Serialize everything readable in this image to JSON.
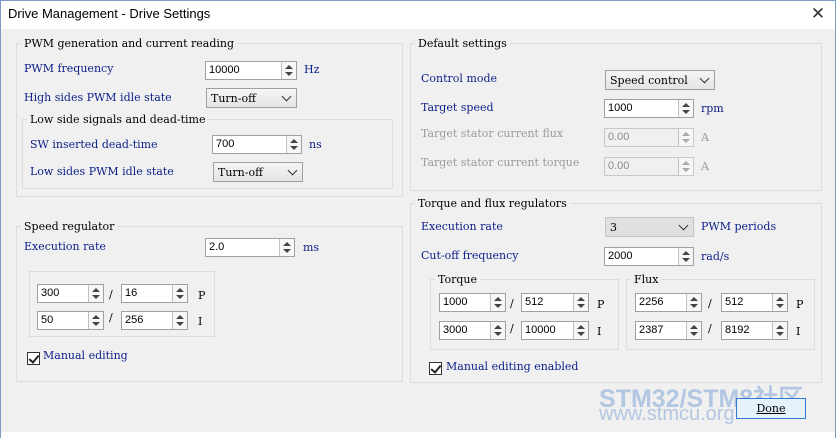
{
  "window": {
    "title": "Drive Management - Drive Settings"
  },
  "pwm": {
    "legend": "PWM generation and current reading",
    "freq_label": "PWM frequency",
    "freq_value": "10000",
    "freq_unit": "Hz",
    "hs_label": "High sides PWM idle state",
    "hs_value": "Turn-off",
    "low": {
      "legend": "Low side signals and dead-time",
      "dead_label": "SW inserted dead-time",
      "dead_value": "700",
      "dead_unit": "ns",
      "ls_label": "Low sides PWM idle state",
      "ls_value": "Turn-off"
    }
  },
  "speed": {
    "legend": "Speed regulator",
    "exec_label": "Execution rate",
    "exec_value": "2.0",
    "exec_unit": "ms",
    "p_num": "300",
    "p_den": "16",
    "p_label": "P",
    "i_num": "50",
    "i_den": "256",
    "i_label": "I",
    "slash": "/",
    "manual_label": "Manual editing"
  },
  "defaults": {
    "legend": "Default settings",
    "mode_label": "Control mode",
    "mode_value": "Speed control",
    "tspeed_label": "Target speed",
    "tspeed_value": "1000",
    "tspeed_unit": "rpm",
    "flux_label": "Target stator current flux",
    "flux_value": "0.00",
    "flux_unit": "A",
    "torque_label": "Target stator current torque",
    "torque_value": "0.00",
    "torque_unit": "A"
  },
  "tf": {
    "legend": "Torque and flux regulators",
    "exec_label": "Execution rate",
    "exec_value": "3",
    "exec_unit": "PWM periods",
    "cutoff_label": "Cut-off frequency",
    "cutoff_value": "2000",
    "cutoff_unit": "rad/s",
    "torque": {
      "legend": "Torque",
      "p_num": "1000",
      "p_den": "512",
      "i_num": "3000",
      "i_den": "10000"
    },
    "flux": {
      "legend": "Flux",
      "p_num": "2256",
      "p_den": "512",
      "i_num": "2387",
      "i_den": "8192"
    },
    "p_label": "P",
    "i_label": "I",
    "slash": "/",
    "manual_label": "Manual editing enabled"
  },
  "done_label": "Done",
  "watermark": {
    "line1": "STM32/STM8社区",
    "line2": "www.stmcu.org"
  }
}
